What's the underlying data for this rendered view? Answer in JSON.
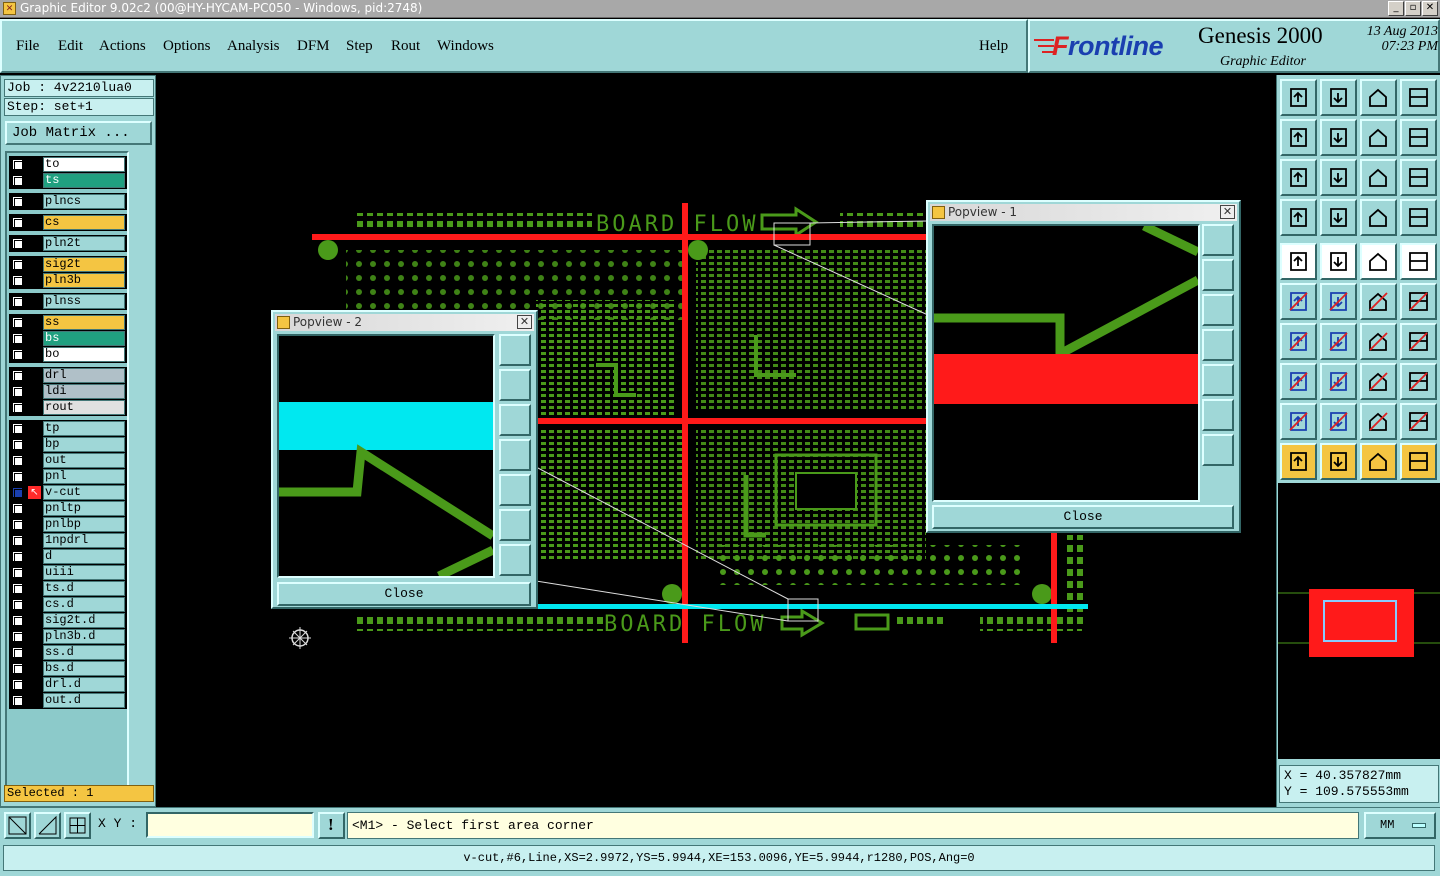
{
  "window": {
    "title": "Graphic Editor 9.02c2 (00@HY-HYCAM-PC050 - Windows, pid:2748)",
    "minimize": "_",
    "maximize": "▫",
    "close": "✕"
  },
  "menu": {
    "file": "File",
    "edit": "Edit",
    "actions": "Actions",
    "options": "Options",
    "analysis": "Analysis",
    "dfm": "DFM",
    "step": "Step",
    "rout": "Rout",
    "windows": "Windows",
    "help": "Help"
  },
  "brand": {
    "logo_f": "F",
    "logo_rest": "rontline",
    "product": "Genesis 2000",
    "subtitle": "Graphic Editor",
    "date": "13 Aug 2013",
    "time": "07:23 PM"
  },
  "job": {
    "job": "Job : 4v2210lua0",
    "step": "Step: set+1",
    "job_matrix": "Job Matrix ..."
  },
  "layers": [
    {
      "name": "to",
      "color": "#ffffff"
    },
    {
      "name": "ts",
      "color": "#20a080"
    },
    {
      "name": "plncs",
      "color": "#9fd7d7"
    },
    {
      "name": "cs",
      "color": "#f4c542"
    },
    {
      "name": "pln2t",
      "color": "#9fd7d7"
    },
    {
      "name": "sig2t",
      "color": "#f4c542"
    },
    {
      "name": "pln3b",
      "color": "#f4c542"
    },
    {
      "name": "plnss",
      "color": "#9fd7d7"
    },
    {
      "name": "ss",
      "color": "#f4c542"
    },
    {
      "name": "bs",
      "color": "#20a080"
    },
    {
      "name": "bo",
      "color": "#ffffff"
    },
    {
      "name": "drl",
      "color": "#b0c0c8"
    },
    {
      "name": "ldi",
      "color": "#b0c0c8"
    },
    {
      "name": "rout",
      "color": "#e0e0e0"
    },
    {
      "name": "tp",
      "color": "#9fd7d7"
    },
    {
      "name": "bp",
      "color": "#9fd7d7"
    },
    {
      "name": "out",
      "color": "#9fd7d7"
    },
    {
      "name": "pnl",
      "color": "#9fd7d7"
    },
    {
      "name": "v-cut",
      "color": "#9fd7d7"
    },
    {
      "name": "pnltp",
      "color": "#9fd7d7"
    },
    {
      "name": "pnlbp",
      "color": "#9fd7d7"
    },
    {
      "name": "1npdrl",
      "color": "#9fd7d7"
    },
    {
      "name": "d",
      "color": "#9fd7d7"
    },
    {
      "name": "uiii",
      "color": "#9fd7d7"
    },
    {
      "name": "ts.d",
      "color": "#9fd7d7"
    },
    {
      "name": "cs.d",
      "color": "#9fd7d7"
    },
    {
      "name": "sig2t.d",
      "color": "#9fd7d7"
    },
    {
      "name": "pln3b.d",
      "color": "#9fd7d7"
    },
    {
      "name": "ss.d",
      "color": "#9fd7d7"
    },
    {
      "name": "bs.d",
      "color": "#9fd7d7"
    },
    {
      "name": "drl.d",
      "color": "#9fd7d7"
    },
    {
      "name": "out.d",
      "color": "#9fd7d7"
    }
  ],
  "selected": "Selected : 1",
  "canvas": {
    "board_flow_top": "BOARD FLOW",
    "board_flow_bottom": "BOARD FLOW"
  },
  "popview1": {
    "title": "Popview - 1",
    "close": "Close"
  },
  "popview2": {
    "title": "Popview - 2",
    "close": "Close"
  },
  "coords": {
    "x": "X = 40.357827mm",
    "y": "Y = 109.575553mm"
  },
  "bottom": {
    "xy_label": "X Y :",
    "xy_value": "",
    "prompt": "<M1> - Select first area corner",
    "units": "MM"
  },
  "status": "v-cut,#6,Line,XS=2.9972,YS=5.9944,XE=153.0096,YE=5.9944,r1280,POS,Ang=0",
  "colors": {
    "panel": "#9fd7d7",
    "trace_green": "#4a9a1a",
    "vcut_red": "#ff1a1a",
    "vcut_cyan": "#00e8f0",
    "highlight": "#f4c542"
  }
}
